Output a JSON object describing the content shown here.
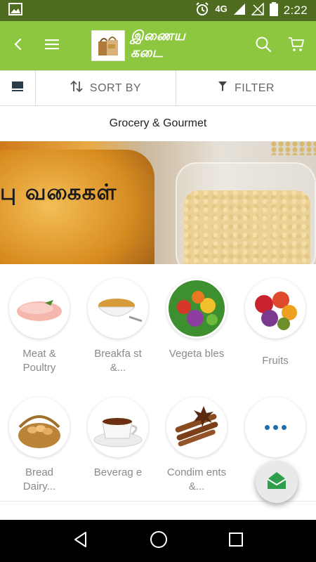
{
  "status_bar": {
    "network": "4G",
    "time": "2:22",
    "icons": [
      "image-icon",
      "alarm-icon",
      "signal-icon",
      "signal-empty-icon",
      "battery-icon"
    ]
  },
  "app_bar": {
    "logo_text": "இணைய கடை",
    "icons": [
      "back-arrow-icon",
      "menu-icon",
      "search-icon",
      "cart-icon"
    ],
    "color": "#8dc63f"
  },
  "toolbar": {
    "sort_label": "SORT BY",
    "filter_label": "FILTER",
    "icons": [
      "view-list-icon",
      "sort-icon",
      "filter-icon"
    ]
  },
  "category": {
    "title": "Grocery & Gourmet"
  },
  "banner": {
    "text": "பு வகைகள்"
  },
  "tiles": [
    {
      "label": "Meat & Poultry",
      "icon": "meat-icon"
    },
    {
      "label": "Breakfa st &...",
      "icon": "cereal-icon"
    },
    {
      "label": "Vegeta bles",
      "icon": "vegetables-icon"
    },
    {
      "label": "Fruits",
      "icon": "fruits-icon"
    },
    {
      "label": "Bread Dairy...",
      "icon": "eggs-basket-icon"
    },
    {
      "label": "Beverag e",
      "icon": "tea-cup-icon"
    },
    {
      "label": "Condim ents &...",
      "icon": "cinnamon-icon"
    },
    {
      "label": "",
      "icon": "more-icon"
    }
  ],
  "fab": {
    "icon": "mail-open-icon"
  },
  "nav_bar": {
    "icons": [
      "back-nav-icon",
      "home-nav-icon",
      "recents-nav-icon"
    ]
  }
}
